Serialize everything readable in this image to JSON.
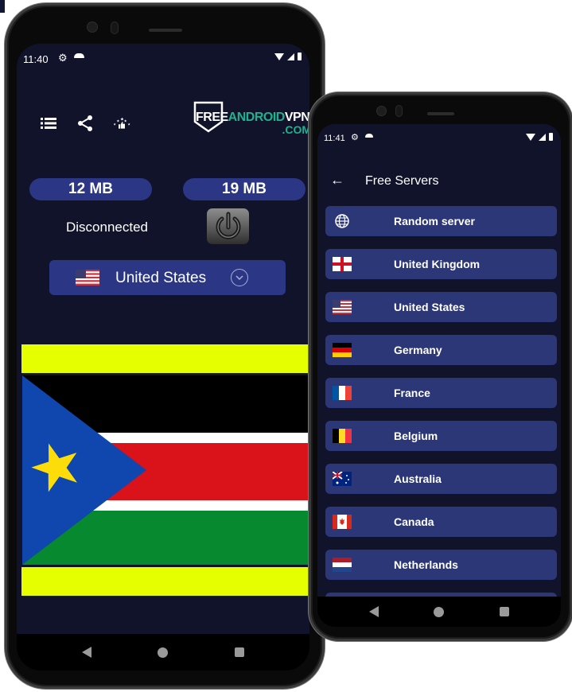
{
  "phone_main": {
    "status_bar": {
      "time": "11:40"
    },
    "toolbar_icons": [
      "list-icon",
      "share-icon",
      "rate-stars-icon"
    ],
    "logo": {
      "part1": "FREE",
      "part2": "ANDROID",
      "part3": "VPN",
      "domain": ".COM"
    },
    "stats": {
      "download": "12 MB",
      "upload": "19 MB"
    },
    "connection_status": "Disconnected",
    "selected_country": {
      "name": "United States",
      "flag": "us"
    },
    "displayed_flag": "south-sudan",
    "colors": {
      "background": "#11132b",
      "accent": "#2b3784",
      "logo_green": "#1fb28c",
      "flag_frame": "#e5ff00"
    }
  },
  "phone_servers": {
    "status_bar": {
      "time": "11:41"
    },
    "header": {
      "title": "Free Servers"
    },
    "servers": [
      {
        "name": "Random server",
        "icon": "globe"
      },
      {
        "name": "United Kingdom",
        "icon": "flag-england"
      },
      {
        "name": "United States",
        "icon": "flag-us"
      },
      {
        "name": "Germany",
        "icon": "flag-de"
      },
      {
        "name": "France",
        "icon": "flag-fr"
      },
      {
        "name": "Belgium",
        "icon": "flag-be"
      },
      {
        "name": "Australia",
        "icon": "flag-au"
      },
      {
        "name": "Canada",
        "icon": "flag-ca"
      },
      {
        "name": "Netherlands",
        "icon": "flag-nl"
      }
    ]
  }
}
